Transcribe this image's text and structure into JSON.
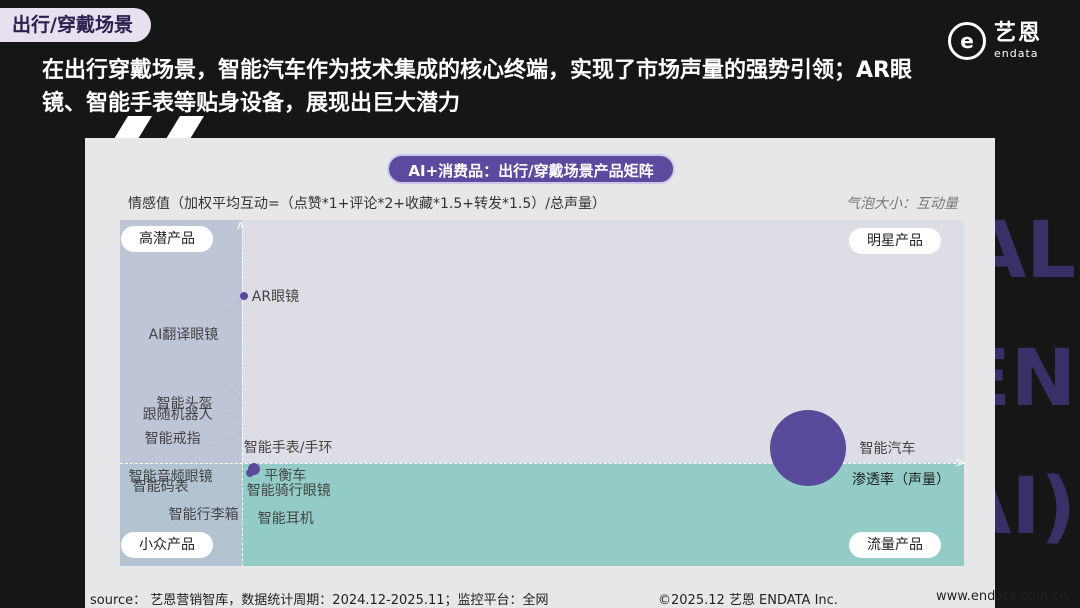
{
  "section_tag": "出行/穿戴场景",
  "logo": {
    "cn": "艺恩",
    "en": "endata",
    "mark": "e"
  },
  "headline": "在出行穿戴场景，智能汽车作为技术集成的核心终端，实现了市场声量的强势引领；AR眼镜、智能手表等贴身设备，展现出巨大潜力",
  "watermark": [
    "AL",
    "EN",
    "AI)"
  ],
  "colors": {
    "bubble": "#5a4a9c",
    "title_pill": "#5b4a9e",
    "lower_zone": "#93ccc6",
    "upper_zone": "#dddde6"
  },
  "chart_data": {
    "type": "scatter",
    "title": "AI+消费品：出行/穿戴场景产品矩阵",
    "ylabel": "情感值（加权平均互动=（点赞*1+评论*2+收藏*1.5+转发*1.5）/总声量）",
    "xlabel": "渗透率（声量）",
    "size_note": "气泡大小：互动量",
    "quadrants": {
      "top_left": "高潜产品",
      "top_right": "明星产品",
      "bottom_left": "小众产品",
      "bottom_right": "流量产品"
    },
    "x_range": [
      0,
      100
    ],
    "y_range": [
      0,
      100
    ],
    "points": [
      {
        "name": "AR眼镜",
        "x": 0.3,
        "y": 78,
        "size": 3
      },
      {
        "name": "AI翻译眼镜",
        "x": 0.1,
        "y": 67,
        "size": 1
      },
      {
        "name": "智能头盔",
        "x": 0.1,
        "y": 47,
        "size": 1
      },
      {
        "name": "跟随机器人",
        "x": 0.1,
        "y": 44,
        "size": 1
      },
      {
        "name": "智能戒指",
        "x": 0.1,
        "y": 37,
        "size": 1
      },
      {
        "name": "智能手表/手环",
        "x": 3,
        "y": 28,
        "size": 6
      },
      {
        "name": "平衡车",
        "x": 2,
        "y": 27,
        "size": 3
      },
      {
        "name": "智能音频眼镜",
        "x": 0.1,
        "y": 26,
        "size": 1
      },
      {
        "name": "智能码表",
        "x": 0.1,
        "y": 23,
        "size": 1
      },
      {
        "name": "智能骑行眼镜",
        "x": 1,
        "y": 22,
        "size": 1
      },
      {
        "name": "智能行李箱",
        "x": 0.1,
        "y": 15,
        "size": 1
      },
      {
        "name": "智能耳机",
        "x": 1,
        "y": 14,
        "size": 1
      },
      {
        "name": "智能汽车",
        "x": 78,
        "y": 34,
        "size": 100
      }
    ]
  },
  "footer": {
    "source": "source： 艺恩营销智库，数据统计周期：2024.12-2025.11；监控平台：全网",
    "copyright": "©2025.12  艺恩 ENDATA Inc.",
    "site": "www.endata.com.cn"
  }
}
